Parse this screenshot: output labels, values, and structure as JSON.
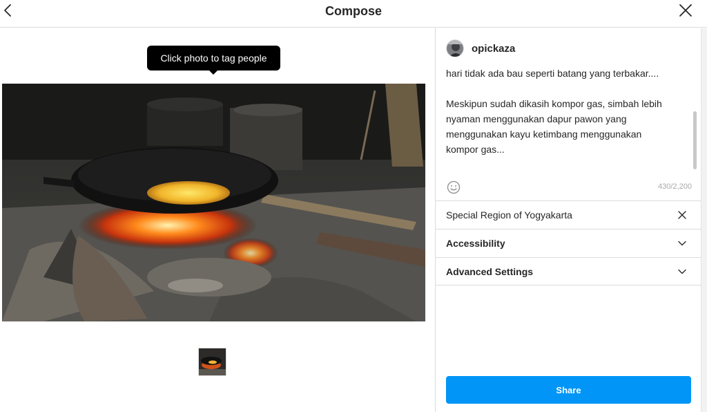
{
  "header": {
    "title": "Compose",
    "back_icon": "chevron-left-icon",
    "close_icon": "close-icon"
  },
  "editor": {
    "tooltip": "Click photo to tag people"
  },
  "composer": {
    "username": "opickaza",
    "caption": {
      "line1": "hari tidak ada bau seperti batang yang terbakar....",
      "line2": "Meskipun sudah dikasih kompor gas, simbah lebih",
      "line3": "nyaman menggunakan dapur pawon yang",
      "line4": "menggunakan kayu ketimbang menggunakan",
      "line5": "kompor gas..."
    },
    "emoji_icon": "smiley-icon",
    "char_count": "430/2,200",
    "location": "Special Region of Yogyakarta",
    "accessibility_label": "Accessibility",
    "advanced_label": "Advanced Settings",
    "share_label": "Share"
  },
  "colors": {
    "accent": "#0095f6",
    "border": "#dbdbdb",
    "text": "#262626",
    "muted": "#a8a8a8"
  }
}
